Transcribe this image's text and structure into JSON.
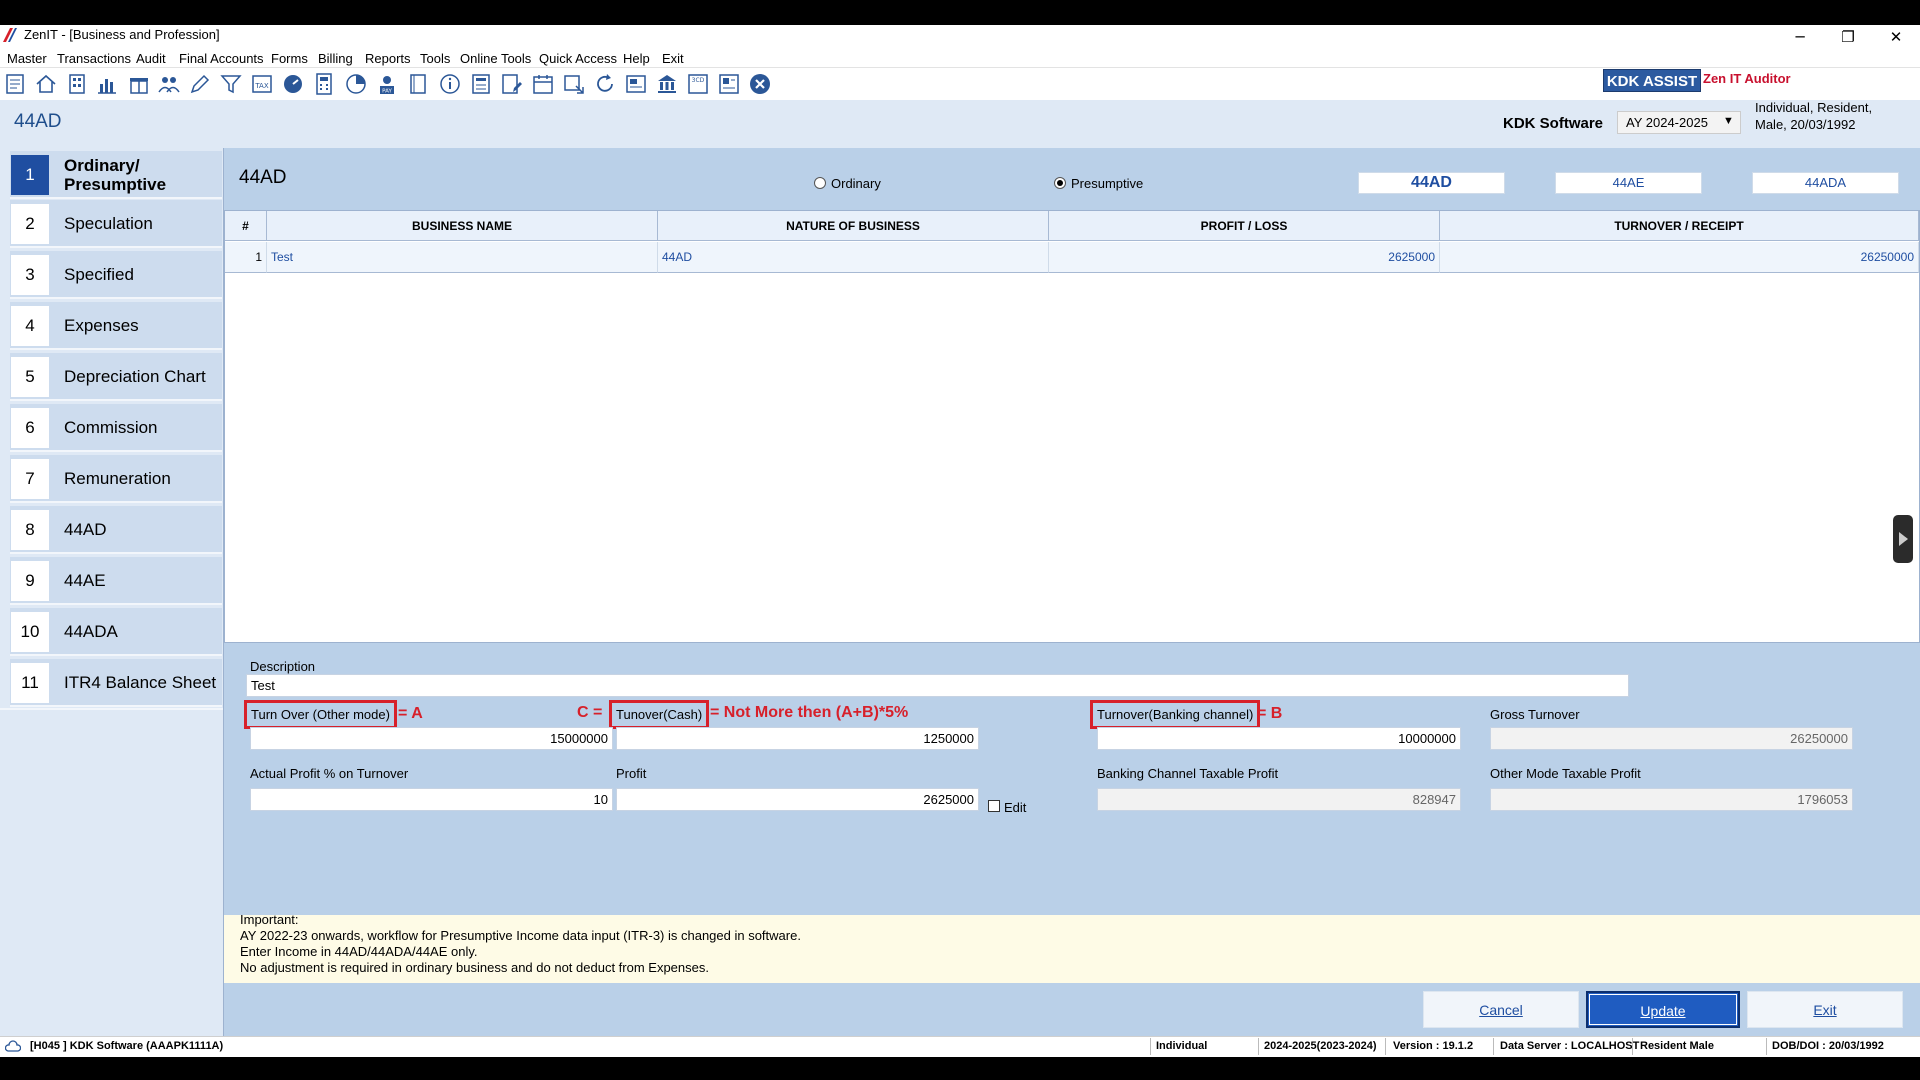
{
  "window": {
    "title": "ZenIT - [Business and Profession]",
    "minimize_glyph": "─",
    "restore_glyph": "❐",
    "close_glyph": "✕"
  },
  "menu": [
    "Master",
    "Transactions",
    "Audit",
    "Final Accounts",
    "Forms",
    "Billing",
    "Reports",
    "Tools",
    "Online Tools",
    "Quick Access",
    "Help",
    "Exit"
  ],
  "toolbar": {
    "icons": [
      "document-icon",
      "home-icon",
      "building-icon",
      "bar-chart-icon",
      "gift-icon",
      "people-icon",
      "pen-icon",
      "filter-icon",
      "tax-icon",
      "speedometer-icon",
      "calculator-icon",
      "pie-chart-icon",
      "pay-icon",
      "book-icon",
      "info-icon",
      "form-icon",
      "edit-form-icon",
      "calendar-icon",
      "import-icon",
      "refresh-icon",
      "card-icon",
      "bank-icon",
      "3cd-icon",
      "report-icon",
      "close-circle-icon"
    ],
    "kdk_assist": "KDK ASSIST",
    "zen_auditor": "Zen IT Auditor"
  },
  "header": {
    "section": "44AD",
    "company": "KDK Software",
    "ay": "AY 2024-2025",
    "profile_line1": "Individual, Resident,",
    "profile_line2": "Male, 20/03/1992"
  },
  "sidebar": {
    "items": [
      {
        "num": "1",
        "label": "Ordinary/ Presumptive"
      },
      {
        "num": "2",
        "label": "Speculation"
      },
      {
        "num": "3",
        "label": "Specified"
      },
      {
        "num": "4",
        "label": "Expenses"
      },
      {
        "num": "5",
        "label": "Depreciation Chart"
      },
      {
        "num": "6",
        "label": "Commission"
      },
      {
        "num": "7",
        "label": "Remuneration"
      },
      {
        "num": "8",
        "label": "44AD"
      },
      {
        "num": "9",
        "label": "44AE"
      },
      {
        "num": "10",
        "label": "44ADA"
      },
      {
        "num": "11",
        "label": "ITR4 Balance Sheet"
      }
    ]
  },
  "panel": {
    "title": "44AD",
    "radio_ordinary": "Ordinary",
    "radio_presumptive": "Presumptive",
    "selected_mode": "Presumptive",
    "tabs": [
      "44AD",
      "44AE",
      "44ADA"
    ]
  },
  "grid": {
    "headers": [
      "#",
      "BUSINESS NAME",
      "NATURE OF BUSINESS",
      "PROFIT / LOSS",
      "TURNOVER / RECEIPT"
    ],
    "rows": [
      {
        "idx": "1",
        "business_name": "Test",
        "nature": "44AD",
        "profit": "2625000",
        "turnover": "26250000"
      }
    ]
  },
  "form": {
    "description_label": "Description",
    "description_value": "Test",
    "turnover_other_label": "Turn Over (Other mode)",
    "turnover_other_value": "15000000",
    "ann_a": "= A",
    "ann_c": "C =",
    "turnover_cash_label": "Tunover(Cash)",
    "turnover_cash_value": "1250000",
    "ann_rule": "= Not More then (A+B)*5%",
    "turnover_bank_label": "Turnover(Banking channel)",
    "turnover_bank_value": "10000000",
    "ann_b": "= B",
    "gross_label": "Gross Turnover",
    "gross_value": "26250000",
    "actual_profit_label": "Actual Profit % on Turnover",
    "actual_profit_value": "10",
    "profit_label": "Profit",
    "profit_value": "2625000",
    "edit_label": "Edit",
    "bank_taxable_label": "Banking Channel Taxable Profit",
    "bank_taxable_value": "828947",
    "other_taxable_label": "Other Mode Taxable Profit",
    "other_taxable_value": "1796053"
  },
  "info": {
    "title": "Important:",
    "line1": "AY 2022-23 onwards, workflow for Presumptive Income data input (ITR-3) is changed in software.",
    "line2": "Enter Income in 44AD/44ADA/44AE only.",
    "line3": "No adjustment is required in ordinary business and do not deduct from Expenses."
  },
  "buttons": {
    "cancel": "Cancel",
    "update": "Update",
    "exit": "Exit"
  },
  "status": {
    "client": "[H045 ] KDK Software (AAAPK1111A)",
    "status_type": "Individual",
    "years": "2024-2025(2023-2024)",
    "version": "Version : 19.1.2",
    "server": "Data Server : LOCALHOST",
    "residency": "Resident Male",
    "dob": "DOB/DOI : 20/03/1992"
  },
  "colors": {
    "accent": "#1f4ea1",
    "annotation": "#d7202a",
    "panel": "#bad0e8"
  }
}
